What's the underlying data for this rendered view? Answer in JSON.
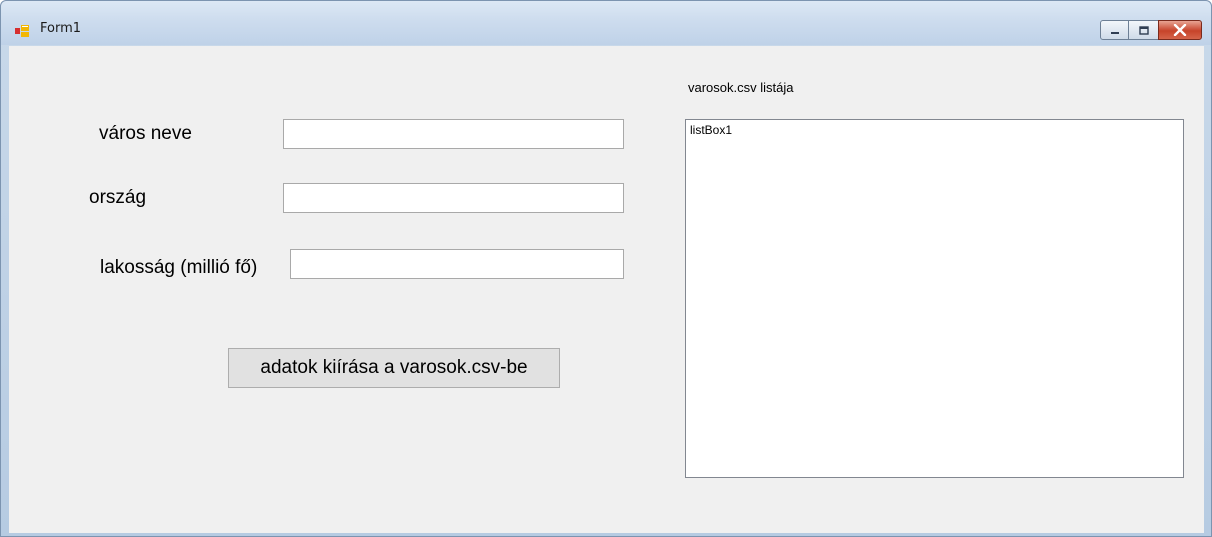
{
  "window": {
    "title": "Form1",
    "icon": "form-app-icon",
    "controls": {
      "minimize_icon": "minimize-icon",
      "maximize_icon": "maximize-icon",
      "close_icon": "close-icon"
    }
  },
  "form": {
    "city_label": "város neve",
    "city_value": "",
    "country_label": "ország",
    "country_value": "",
    "population_label": "lakosság (millió fő)",
    "population_value": "",
    "write_button_label": "adatok kiírása a varosok.csv-be"
  },
  "list": {
    "title": "varosok.csv listája",
    "items": [
      "listBox1"
    ]
  },
  "colors": {
    "title_bar": "#cddcee",
    "client_background": "#f0f0f0",
    "close_button": "#c7432a",
    "button_face": "#e1e1e1"
  }
}
